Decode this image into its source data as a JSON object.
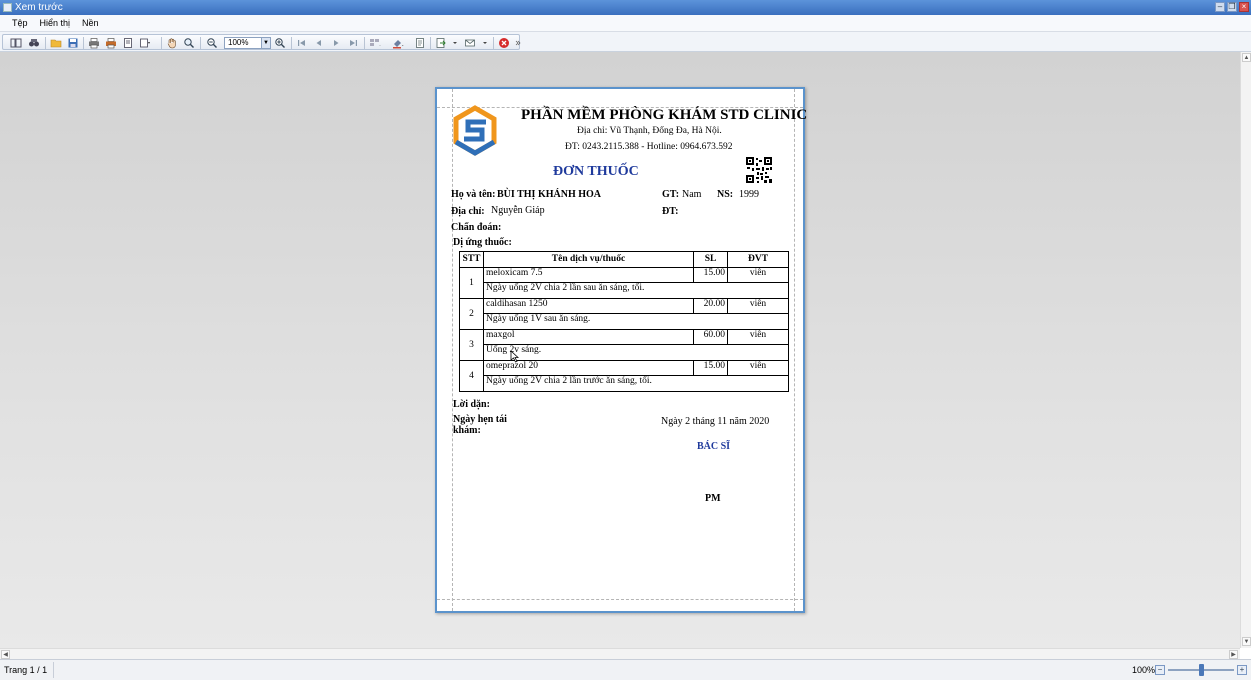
{
  "window": {
    "title": "Xem trước"
  },
  "menu": [
    "Tệp",
    "Hiển thị",
    "Nền"
  ],
  "toolbar": {
    "zoom_value": "100%"
  },
  "status": {
    "page": "Trang 1 / 1",
    "zoom": "100%",
    "zoom_level": 0.5
  },
  "document": {
    "clinic_name": "PHẦN MỀM PHÒNG KHÁM STD CLINIC",
    "address": "Địa chỉ: Vũ Thạnh, Đống Đa, Hà Nội.",
    "phone": "ĐT: 0243.2115.388 - Hotline: 0964.673.592",
    "title": "ĐƠN THUỐC",
    "patient": {
      "name_label": "Họ và tên:",
      "name": "BÙI THỊ KHÁNH HOA",
      "gender_label": "GT:",
      "gender": "Nam",
      "dob_label": "NS:",
      "dob": "1999",
      "address_label": "Địa chỉ:",
      "address": "Nguyễn Giáp",
      "phone_label": "ĐT:",
      "diagnosis_label": "Chẩn đoán:",
      "allergy_label": "Dị ứng thuốc:"
    },
    "table": {
      "headers": [
        "STT",
        "Tên dịch vụ/thuốc",
        "SL",
        "ĐVT"
      ],
      "rows": [
        {
          "stt": "1",
          "name": "meloxicam 7.5",
          "qty": "15.00",
          "unit": "viên",
          "usage": "Ngày uống 2V chia 2 lần sau ăn sáng, tối."
        },
        {
          "stt": "2",
          "name": "caldihasan 1250",
          "qty": "20.00",
          "unit": "viên",
          "usage": "Ngày uống 1V sau ăn sáng."
        },
        {
          "stt": "3",
          "name": "maxgol",
          "qty": "60.00",
          "unit": "viên",
          "usage": "Uống 2v sáng."
        },
        {
          "stt": "4",
          "name": "omeprazol 20",
          "qty": "15.00",
          "unit": "viên",
          "usage": "Ngày uống 2V chia 2 lần trước ăn sáng, tối."
        }
      ]
    },
    "advice_label": "Lời dặn:",
    "revisit_label_1": "Ngày hẹn tái",
    "revisit_label_2": "khám:",
    "date": "Ngày 2 tháng 11 năm 2020",
    "doctor_label": "BÁC SĨ",
    "doctor_name": "PM"
  },
  "colors": {
    "accent": "#1f3a9c",
    "logo_orange": "#f0961c",
    "logo_blue": "#2f6fb8",
    "frame": "#5b93cc"
  }
}
